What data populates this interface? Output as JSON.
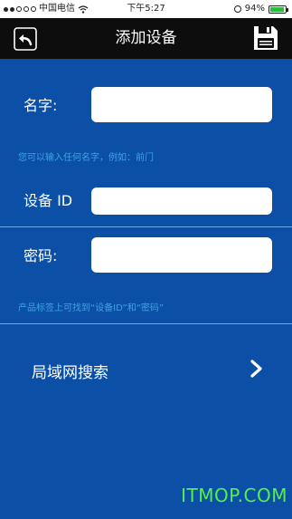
{
  "status_bar": {
    "carrier": "中国电信",
    "time": "下午5:27",
    "battery": "94%",
    "battery_level": 0.94
  },
  "header": {
    "title": "添加设备",
    "back_icon": "back-arrow-icon",
    "save_icon": "floppy-disk-icon"
  },
  "form": {
    "name_label": "名字:",
    "name_value": "",
    "name_hint": "您可以输入任何名字，例如：前门",
    "device_id_label": "设备 ID",
    "device_id_value": "",
    "password_label": "密码:",
    "password_value": "",
    "credentials_hint": "产品标签上可找到“设备ID”和“密码”"
  },
  "lan_search": {
    "label": "局域网搜索",
    "icon": "chevron-right-icon"
  },
  "watermark": "ITMOP.COM",
  "colors": {
    "background": "#0b4fa6",
    "header": "#0d0d0d",
    "hint": "#3fa3e6",
    "watermark": "#55f04a"
  }
}
